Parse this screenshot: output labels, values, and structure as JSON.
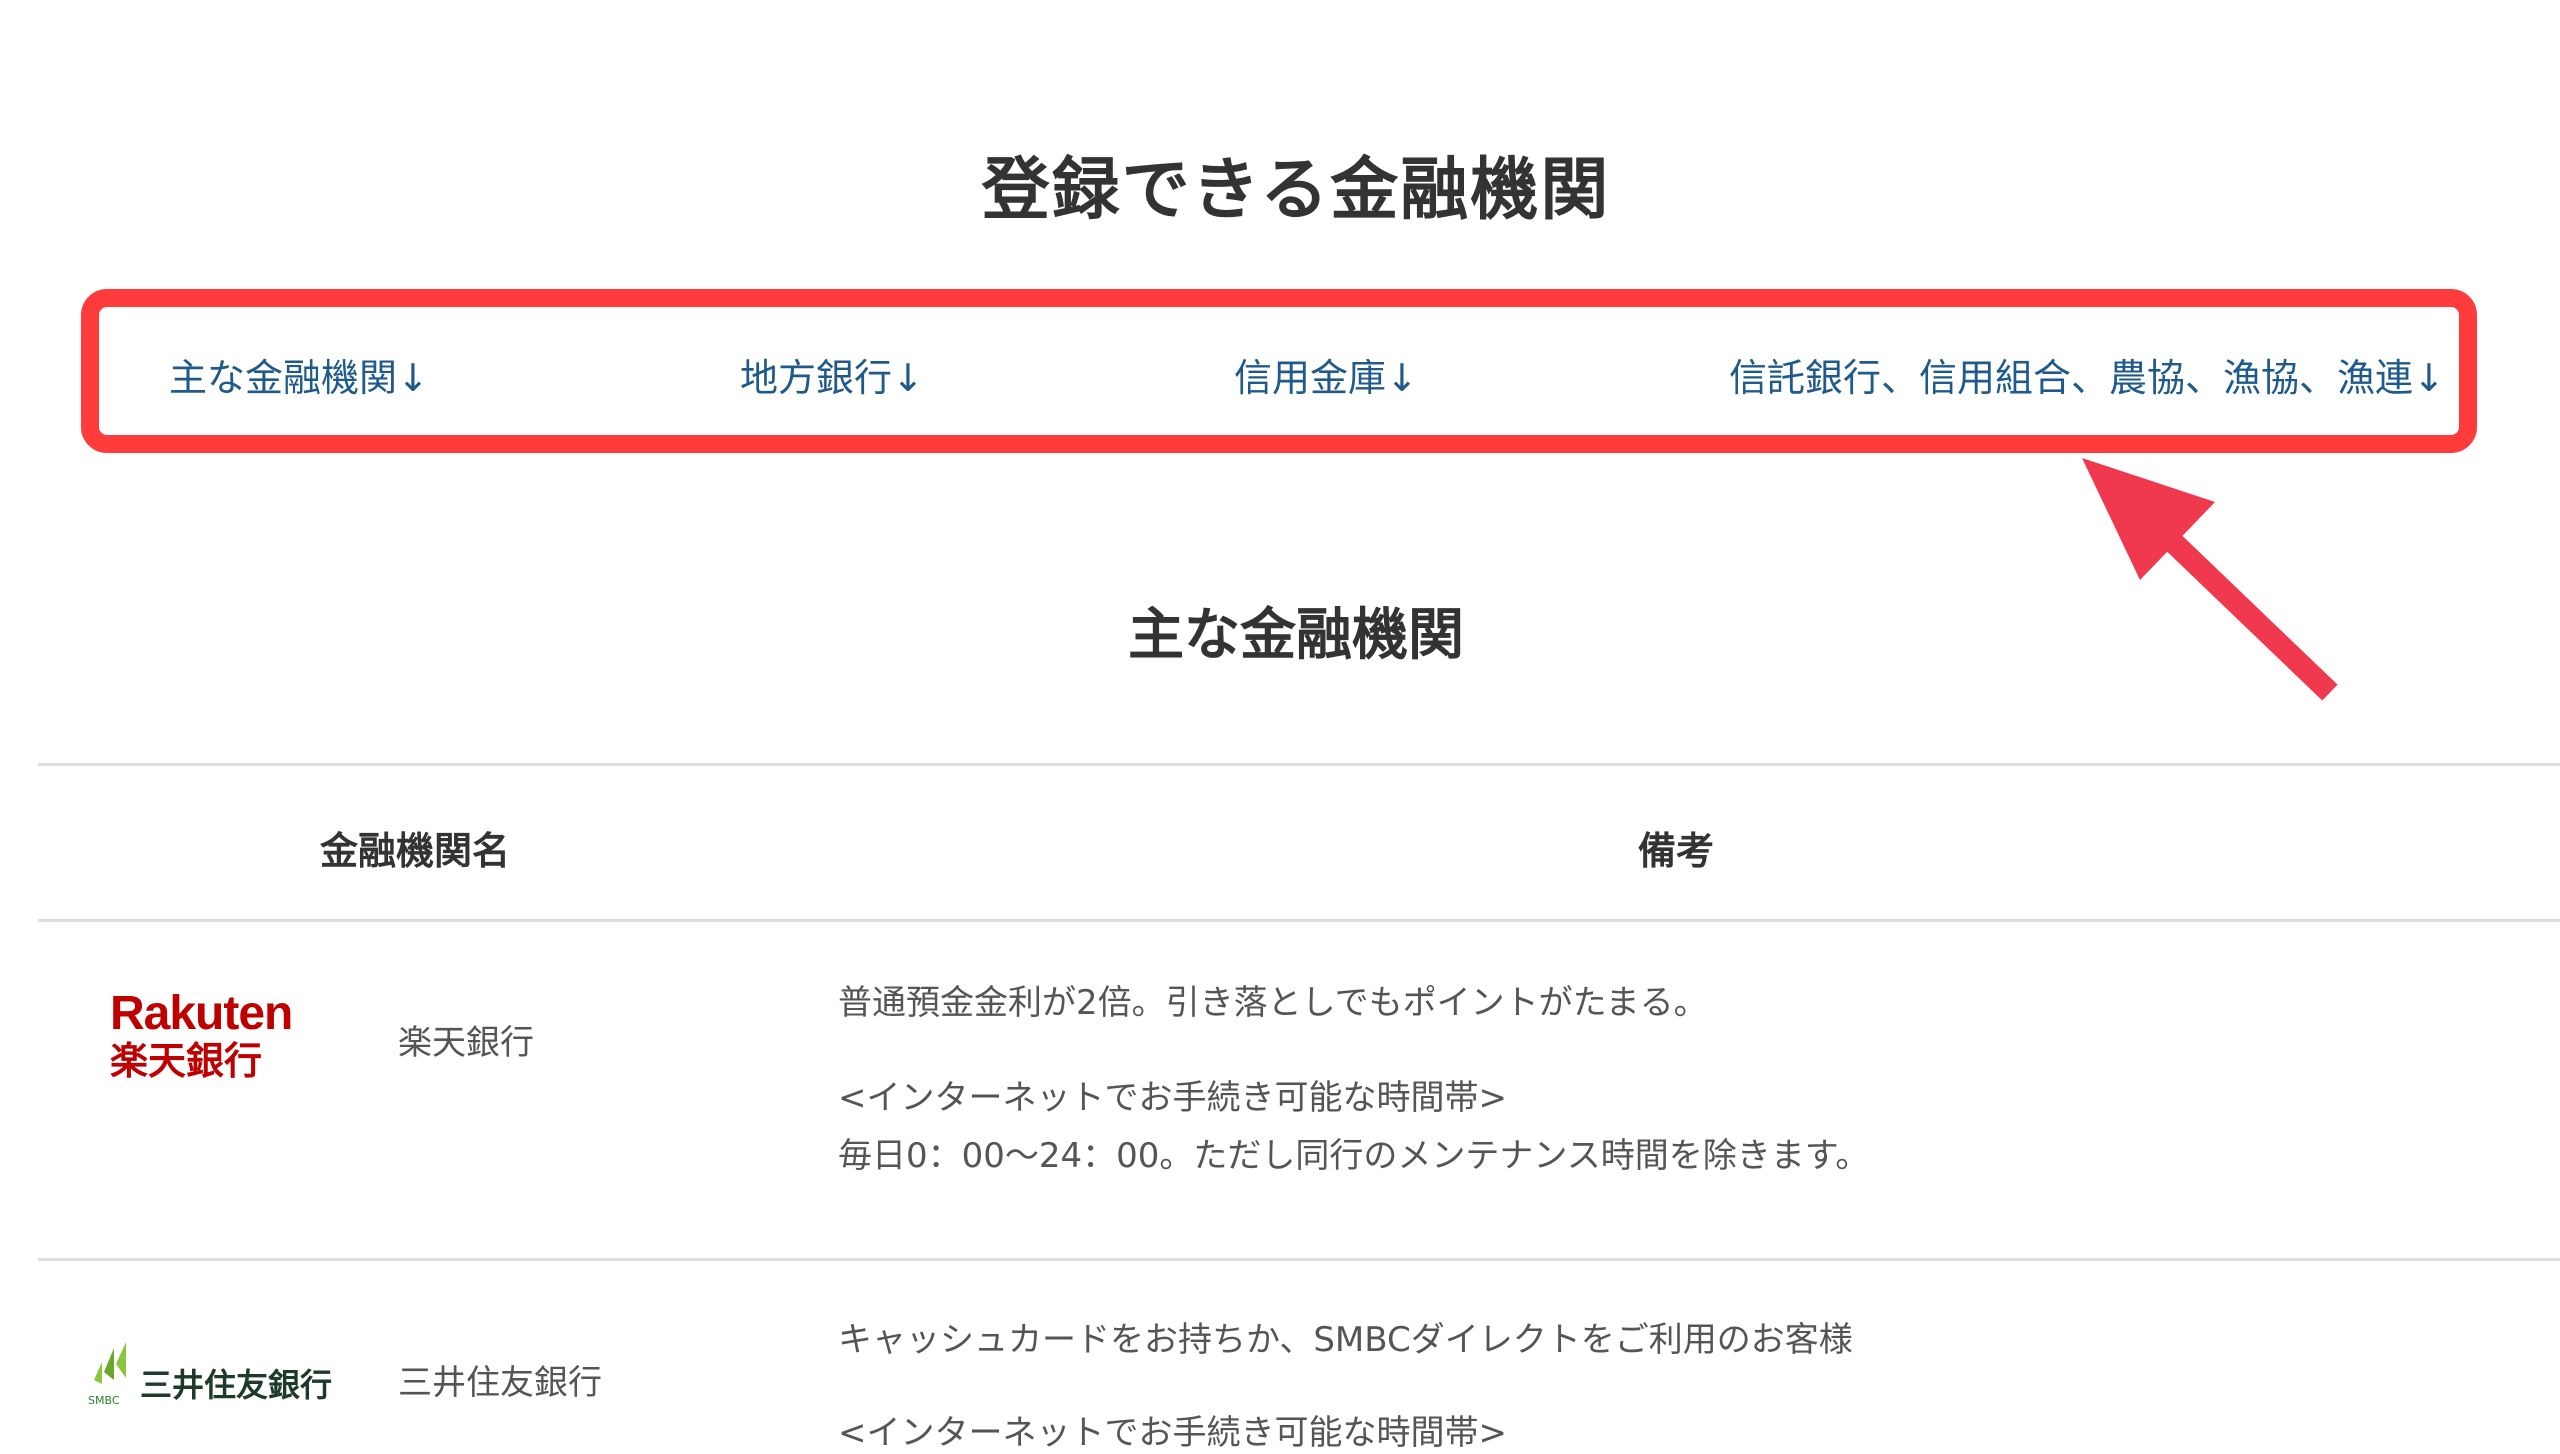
{
  "page_title": "登録できる金融機関",
  "anchor_nav": [
    {
      "label": "主な金融機関↓"
    },
    {
      "label": "地方銀行↓"
    },
    {
      "label": "信用金庫↓"
    },
    {
      "label": "信託銀行、信用組合、農協、漁協、漁連↓"
    }
  ],
  "section_title": "主な金融機関",
  "table": {
    "headers": [
      "金融機関名",
      "備考"
    ],
    "rows": [
      {
        "logo_en": "Rakuten",
        "logo_ja": "楽天銀行",
        "name": "楽天銀行",
        "note_lines": [
          "普通預金金利が2倍。引き落としでもポイントがたまる。",
          "<インターネットでお手続き可能な時間帯>",
          "毎日0：00〜24：00。ただし同行のメンテナンス時間を除きます。"
        ]
      },
      {
        "logo_ja": "三井住友銀行",
        "logo_mark_text": "SMBC",
        "name": "三井住友銀行",
        "note_lines": [
          "キャッシュカードをお持ちか、SMBCダイレクトをご利用のお客様",
          "<インターネットでお手続き可能な時間帯>"
        ]
      }
    ]
  },
  "colors": {
    "highlight_border": "#ff3b3b",
    "link": "#1f5a8a",
    "arrow": "#f0384f",
    "rakuten_red": "#bf0000",
    "smbc_green": "#8cc63f"
  }
}
